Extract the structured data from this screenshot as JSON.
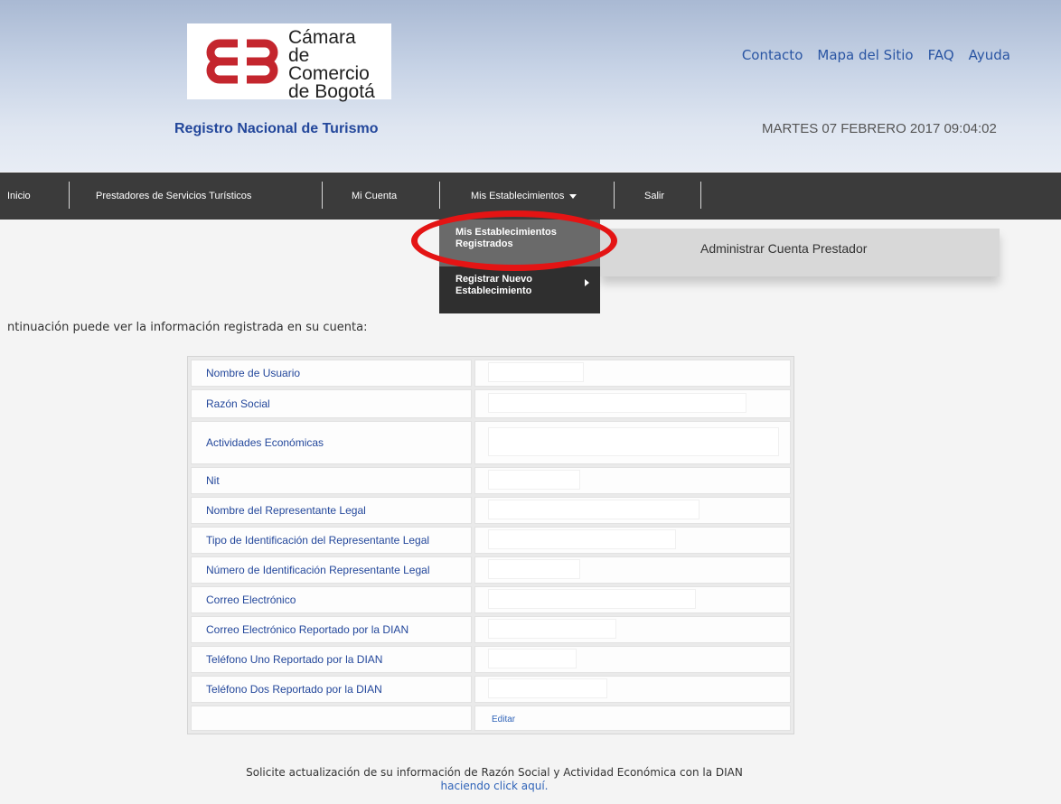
{
  "header": {
    "logo": {
      "line1": "Cámara",
      "line2": "de Comercio",
      "line3": "de Bogotá",
      "brand_color": "#c4262e"
    },
    "links": [
      "Contacto",
      "Mapa del Sitio",
      "FAQ",
      "Ayuda"
    ],
    "site_title": "Registro Nacional de Turismo",
    "datetime": "MARTES 07 FEBRERO 2017 09:04:02"
  },
  "nav": {
    "inicio": "Inicio",
    "prestadores": "Prestadores de Servicios Turísticos",
    "mi_cuenta": "Mi Cuenta",
    "mis_establecimientos": "Mis Establecimientos",
    "salir": "Salir"
  },
  "dropdown": {
    "item1_line1": "Mis Establecimientos",
    "item1_line2": "Registrados",
    "item2_line1": "Registrar Nuevo",
    "item2_line2": "Establecimiento",
    "highlight_color": "#e41414"
  },
  "admin_panel": {
    "title": "Administrar Cuenta Prestador"
  },
  "intro": "ntinuación puede ver la información registrada en su cuenta:",
  "table": {
    "rows": [
      "Nombre de Usuario",
      "Razón Social",
      "Actividades Económicas",
      "Nit",
      "Nombre del Representante Legal",
      "Tipo de Identificación del Representante Legal",
      "Número de Identificación Representante Legal",
      "Correo Electrónico",
      "Correo Electrónico Reportado por la DIAN",
      "Teléfono Uno Reportado por la DIAN",
      "Teléfono Dos Reportado por la DIAN"
    ],
    "edit": "Editar"
  },
  "footer": {
    "line1": "Solicite actualización de su información de Razón Social y Actividad Económica con la DIAN",
    "link": "haciendo click aquí."
  }
}
